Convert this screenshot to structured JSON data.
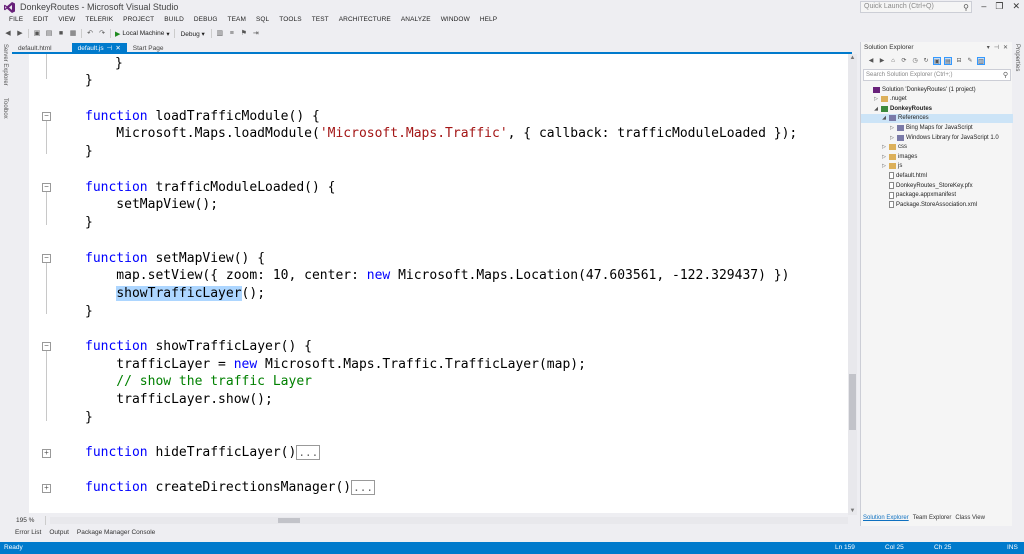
{
  "window": {
    "title": "DonkeyRoutes - Microsoft Visual Studio",
    "quick_launch_placeholder": "Quick Launch (Ctrl+Q)",
    "buttons": [
      "–",
      "❐",
      "✕"
    ]
  },
  "menu": [
    "FILE",
    "EDIT",
    "VIEW",
    "TELERIK",
    "PROJECT",
    "BUILD",
    "DEBUG",
    "TEAM",
    "SQL",
    "TOOLS",
    "TEST",
    "ARCHITECTURE",
    "ANALYZE",
    "WINDOW",
    "HELP"
  ],
  "toolbar": {
    "run_target": "Local Machine",
    "configuration": "Debug"
  },
  "side_panels": {
    "left": [
      "Server Explorer",
      "Toolbox"
    ],
    "right": [
      "Properties"
    ]
  },
  "tabs": [
    {
      "label": "default.html",
      "active": false
    },
    {
      "label": "default.js",
      "active": true
    },
    {
      "label": "Start Page",
      "active": false
    }
  ],
  "code": {
    "l1": "}",
    "l2": "}",
    "f1_sig": "loadTrafficModule() {",
    "f1_body_a": "    Microsoft.Maps.loadModule(",
    "f1_body_str": "'Microsoft.Maps.Traffic'",
    "f1_body_b": ", { callback: trafficModuleLoaded });",
    "f1_end": "}",
    "f2_sig": "trafficModuleLoaded() {",
    "f2_body": "    setMapView();",
    "f2_end": "}",
    "f3_sig": "setMapView() {",
    "f3_body_a": "    map.setView({ zoom: 10, center: ",
    "f3_body_new": "new",
    "f3_body_b": " Microsoft.Maps.Location(47.603561, -122.329437) })",
    "f3_call_indent": "    ",
    "f3_call_hl": "showTrafficLayer",
    "f3_call_rest": "();",
    "f3_end": "}",
    "f4_sig": "showTrafficLayer() {",
    "f4_body_a": "    trafficLayer = ",
    "f4_body_new": "new",
    "f4_body_b": " Microsoft.Maps.Traffic.TrafficLayer(map);",
    "f4_comment": "    // show the traffic Layer",
    "f4_body2": "    trafficLayer.show();",
    "f4_end": "}",
    "f5_sig": "hideTrafficLayer()",
    "f6_sig": "createDirectionsManager()",
    "keyword_function": "function",
    "collapsed_marker": "...",
    "fold_minus": "−",
    "fold_plus": "+"
  },
  "editor": {
    "zoom": "195 %"
  },
  "bottom_tabs": [
    "Error List",
    "Output",
    "Package Manager Console"
  ],
  "solution_explorer": {
    "title": "Solution Explorer",
    "search_placeholder": "Search Solution Explorer (Ctrl+;)",
    "tree": [
      {
        "label": "Solution 'DonkeyRoutes' (1 project)",
        "icon": "solution",
        "level": 0,
        "expander": ""
      },
      {
        "label": ".nuget",
        "icon": "folder",
        "level": 1,
        "expander": "▷"
      },
      {
        "label": "DonkeyRoutes",
        "icon": "project",
        "level": 1,
        "expander": "◢",
        "bold": true
      },
      {
        "label": "References",
        "icon": "references",
        "level": 2,
        "expander": "◢",
        "selected": true
      },
      {
        "label": "Bing Maps for JavaScript",
        "icon": "references",
        "level": 3,
        "expander": "▷"
      },
      {
        "label": "Windows Library for JavaScript 1.0",
        "icon": "references",
        "level": 3,
        "expander": "▷"
      },
      {
        "label": "css",
        "icon": "folder",
        "level": 2,
        "expander": "▷"
      },
      {
        "label": "images",
        "icon": "folder",
        "level": 2,
        "expander": "▷"
      },
      {
        "label": "js",
        "icon": "folder",
        "level": 2,
        "expander": "▷"
      },
      {
        "label": "default.html",
        "icon": "file",
        "level": 2,
        "expander": ""
      },
      {
        "label": "DonkeyRoutes_StoreKey.pfx",
        "icon": "file",
        "level": 2,
        "expander": ""
      },
      {
        "label": "package.appxmanifest",
        "icon": "file",
        "level": 2,
        "expander": ""
      },
      {
        "label": "Package.StoreAssociation.xml",
        "icon": "file",
        "level": 2,
        "expander": ""
      }
    ],
    "bottom_tabs": [
      "Solution Explorer",
      "Team Explorer",
      "Class View"
    ]
  },
  "status": {
    "state": "Ready",
    "line": "Ln 159",
    "col": "Col 25",
    "ch": "Ch 25",
    "mode": "INS"
  },
  "colors": {
    "accent": "#007acc",
    "keyword": "#0000ff",
    "string": "#a31515",
    "comment": "#008000",
    "highlight": "#add6ff"
  }
}
